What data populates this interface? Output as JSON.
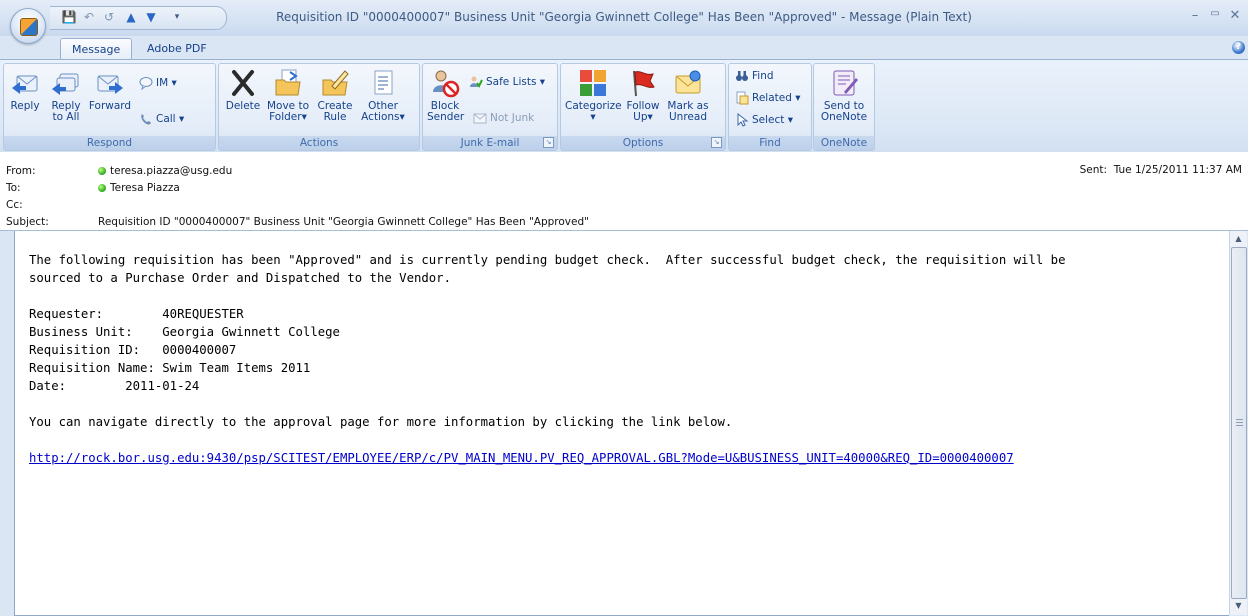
{
  "window": {
    "title": "Requisition ID \"0000400007\" Business Unit \"Georgia Gwinnett College\" Has Been \"Approved\" - Message (Plain Text)"
  },
  "tabs": [
    "Message",
    "Adobe PDF"
  ],
  "ribbon": {
    "respond": {
      "label": "Respond",
      "reply": "Reply",
      "reply_all_1": "Reply",
      "reply_all_2": "to All",
      "forward": "Forward",
      "im": "IM",
      "call": "Call"
    },
    "actions": {
      "label": "Actions",
      "delete": "Delete",
      "move_1": "Move to",
      "move_2": "Folder",
      "create_1": "Create",
      "create_2": "Rule",
      "other_1": "Other",
      "other_2": "Actions"
    },
    "junk": {
      "label": "Junk E-mail",
      "block_1": "Block",
      "block_2": "Sender",
      "safe_lists": "Safe Lists",
      "not_junk": "Not Junk"
    },
    "options": {
      "label": "Options",
      "categorize": "Categorize",
      "follow_1": "Follow",
      "follow_2": "Up",
      "mark_1": "Mark as",
      "mark_2": "Unread"
    },
    "find": {
      "label": "Find",
      "find": "Find",
      "related": "Related",
      "select": "Select"
    },
    "onenote": {
      "label": "OneNote",
      "send_1": "Send to",
      "send_2": "OneNote"
    }
  },
  "header": {
    "from_label": "From:",
    "from": "teresa.piazza@usg.edu",
    "to_label": "To:",
    "to": "Teresa Piazza",
    "cc_label": "Cc:",
    "subject_label": "Subject:",
    "subject": "Requisition ID \"0000400007\" Business Unit \"Georgia Gwinnett College\" Has Been \"Approved\"",
    "sent_label": "Sent:",
    "sent": "Tue 1/25/2011 11:37 AM"
  },
  "body": {
    "para1": "The following requisition has been \"Approved\" and is currently pending budget check.  After successful budget check, the requisition will be\nsourced to a Purchase Order and Dispatched to the Vendor.",
    "fields": "Requester:        40REQUESTER\nBusiness Unit:    Georgia Gwinnett College\nRequisition ID:   0000400007\nRequisition Name: Swim Team Items 2011\nDate:        2011-01-24",
    "para2": "You can navigate directly to the approval page for more information by clicking the link below.",
    "link": "http://rock.bor.usg.edu:9430/psp/SCITEST/EMPLOYEE/ERP/c/PV_MAIN_MENU.PV_REQ_APPROVAL.GBL?Mode=U&BUSINESS_UNIT=40000&REQ_ID=0000400007"
  }
}
